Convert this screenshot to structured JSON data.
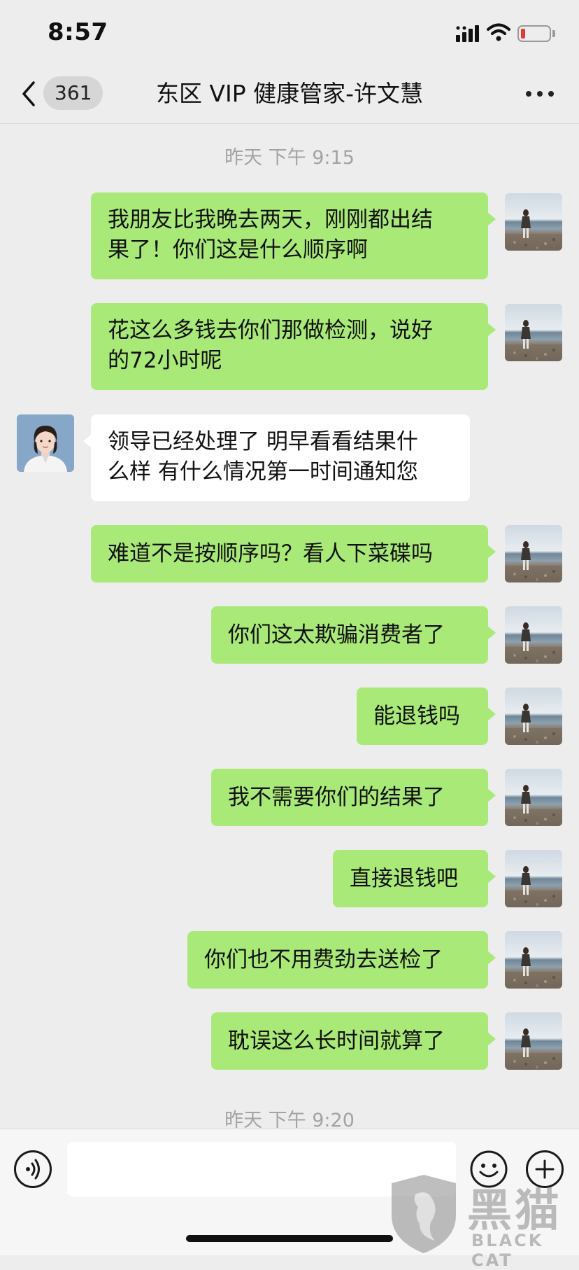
{
  "status_bar": {
    "time": "8:57",
    "battery_level": 0.15,
    "battery_color": "#e53935"
  },
  "nav": {
    "unread_count": "361",
    "title": "东区 VIP 健康管家-许文慧"
  },
  "messages": {
    "ts1": "昨天 下午 9:15",
    "m1": "我朋友比我晚去两天，刚刚都出结\n果了！你们这是什么顺序啊",
    "m2": "花这么多钱去你们那做检测，说好\n的72小时呢",
    "m3": "领导已经处理了 明早看看结果什\n么样 有什么情况第一时间通知您",
    "m4": "难道不是按顺序吗？看人下菜碟吗",
    "m5": "你们这太欺骗消费者了",
    "m6": "能退钱吗",
    "m7": "我不需要你们的结果了",
    "m8": "直接退钱吧",
    "m9": "你们也不用费劲去送检了",
    "m10": "耽误这么长时间就算了",
    "ts2": "昨天 下午 9:20"
  },
  "input": {
    "value": ""
  },
  "watermark": {
    "brand": "黑猫",
    "sub": "BLACK CAT"
  },
  "colors": {
    "sent_bubble": "#a9e977",
    "received_bubble": "#ffffff",
    "background": "#ededed"
  },
  "icons": [
    "back-icon",
    "more-icon",
    "voice-icon",
    "emoji-icon",
    "plus-icon",
    "signal-icon",
    "wifi-icon",
    "battery-icon"
  ]
}
